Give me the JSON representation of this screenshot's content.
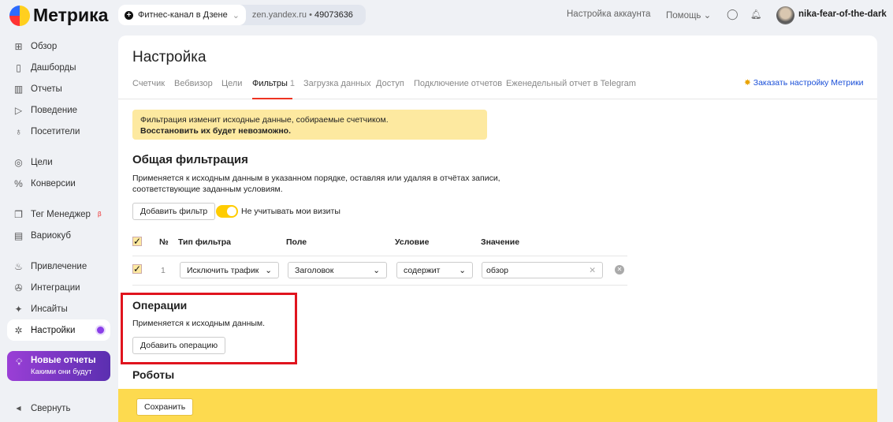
{
  "header": {
    "logo": "Метрика",
    "counter_name": "Фитнес-канал в Дзене",
    "counter_domain": "zen.yandex.ru",
    "counter_id": "49073636",
    "account_settings": "Настройка аккаунта",
    "help": "Помощь",
    "username": "nika-fear-of-the-dark"
  },
  "sidebar": {
    "items": [
      {
        "label": "Обзор",
        "icon": "⊞"
      },
      {
        "label": "Дашборды",
        "icon": "▯"
      },
      {
        "label": "Отчеты",
        "icon": "▥"
      },
      {
        "label": "Поведение",
        "icon": "▷"
      },
      {
        "label": "Посетители",
        "icon": "♁"
      },
      {
        "label": "Цели",
        "icon": "◎"
      },
      {
        "label": "Конверсии",
        "icon": "%"
      },
      {
        "label": "Тег Менеджер",
        "icon": "❐",
        "badge": "β"
      },
      {
        "label": "Вариокуб",
        "icon": "▤"
      },
      {
        "label": "Привлечение",
        "icon": "♨"
      },
      {
        "label": "Интеграции",
        "icon": "✇"
      },
      {
        "label": "Инсайты",
        "icon": "✦"
      },
      {
        "label": "Настройки",
        "icon": "✲"
      }
    ],
    "new_reports_title": "Новые отчеты",
    "new_reports_sub": "Какими они будут",
    "collapse": "Свернуть"
  },
  "page": {
    "title": "Настройка",
    "tabs": [
      "Счетчик",
      "Вебвизор",
      "Цели",
      "Фильтры",
      "Загрузка данных",
      "Доступ",
      "Подключение отчетов",
      "Еженедельный отчет в Telegram"
    ],
    "filters_count": "1",
    "order_link": "Заказать настройку Метрики",
    "warning_line1": "Фильтрация изменит исходные данные, собираемые счетчиком.",
    "warning_line2": "Восстановить их будет невозможно.",
    "general_title": "Общая фильтрация",
    "general_desc1": "Применяется к исходным данным в указанном порядке, оставляя или удаляя в отчётах записи,",
    "general_desc2": "соответствующие заданным условиям.",
    "add_filter": "Добавить фильтр",
    "ignore_visits": "Не учитывать мои визиты",
    "table": {
      "headers": [
        "№",
        "Тип фильтра",
        "Поле",
        "Условие",
        "Значение"
      ],
      "row": {
        "num": "1",
        "type": "Исключить трафик",
        "field": "Заголовок",
        "condition": "содержит",
        "value": "обзор"
      }
    },
    "ops_title": "Операции",
    "ops_desc": "Применяется к исходным данным.",
    "add_op": "Добавить операцию",
    "robots_title": "Роботы",
    "save": "Сохранить"
  }
}
